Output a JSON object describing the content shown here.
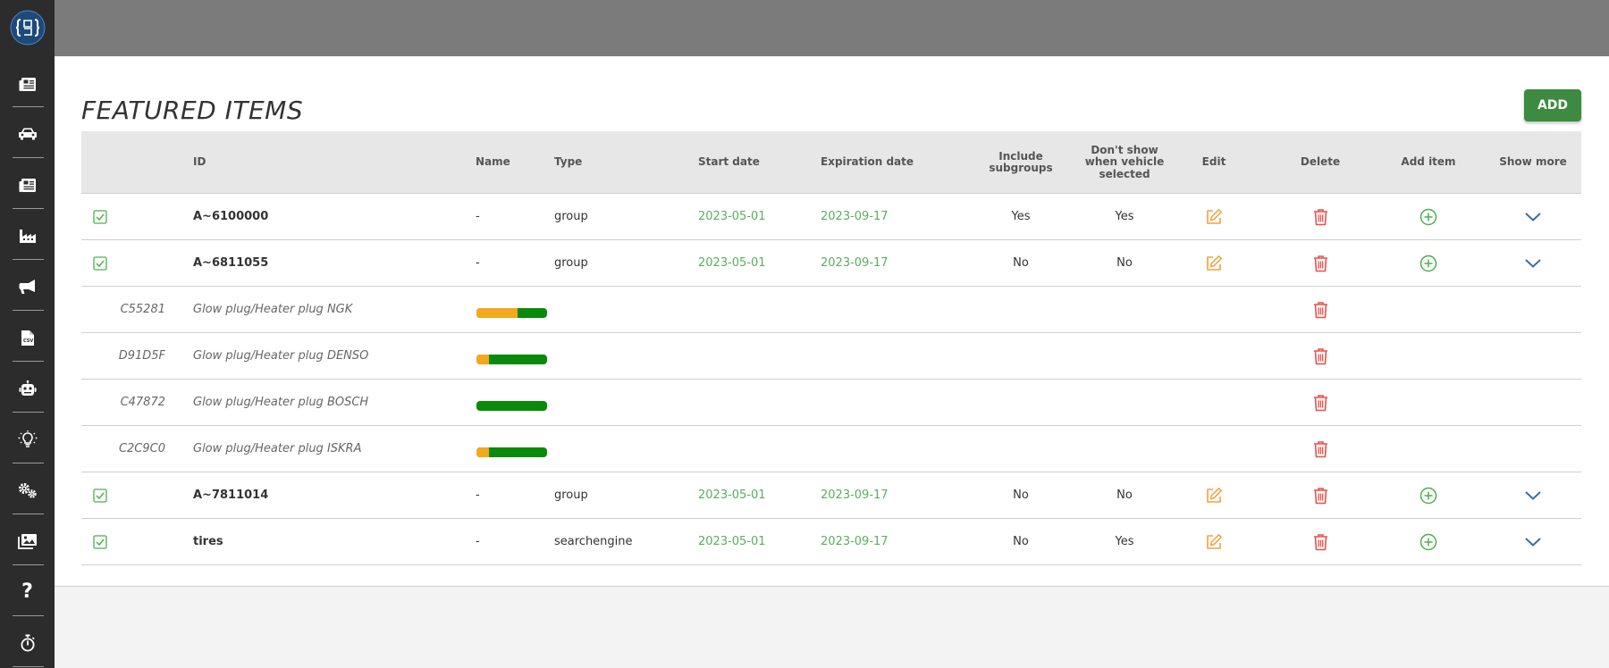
{
  "page": {
    "title": "FEATURED ITEMS",
    "add_label": "ADD"
  },
  "columns": {
    "id": "ID",
    "name": "Name",
    "type": "Type",
    "start_date": "Start date",
    "expiration_date": "Expiration date",
    "include_subgroups": "Include subgroups",
    "dont_show": "Don't show when vehicle selected",
    "edit": "Edit",
    "delete": "Delete",
    "add_item": "Add item",
    "show_more": "Show more"
  },
  "rows": [
    {
      "id": "A~6100000",
      "name": "-",
      "type": "group",
      "start": "2023-05-01",
      "exp": "2023-09-17",
      "include": "Yes",
      "dontshow": "Yes"
    },
    {
      "id": "A~6811055",
      "name": "-",
      "type": "group",
      "start": "2023-05-01",
      "exp": "2023-09-17",
      "include": "No",
      "dontshow": "No"
    },
    {
      "id": "A~7811014",
      "name": "-",
      "type": "group",
      "start": "2023-05-01",
      "exp": "2023-09-17",
      "include": "No",
      "dontshow": "No"
    },
    {
      "id": "tires",
      "name": "-",
      "type": "searchengine",
      "start": "2023-05-01",
      "exp": "2023-09-17",
      "include": "No",
      "dontshow": "Yes"
    }
  ],
  "subitems": [
    {
      "code": "C55281",
      "name": "Glow plug/Heater plug NGK",
      "orange_fraction": 0.58
    },
    {
      "code": "D91D5F",
      "name": "Glow plug/Heater plug DENSO",
      "orange_fraction": 0.18
    },
    {
      "code": "C47872",
      "name": "Glow plug/Heater plug BOSCH",
      "orange_fraction": 0.0
    },
    {
      "code": "C2C9C0",
      "name": "Glow plug/Heater plug ISKRA",
      "orange_fraction": 0.18
    }
  ],
  "sidebar": {
    "icons": [
      "news-icon",
      "car-icon",
      "news-icon",
      "factory-icon",
      "megaphone-icon",
      "csv-file-icon",
      "robot-icon",
      "lightbulb-icon",
      "gears-icon",
      "images-icon",
      "help-icon",
      "stopwatch-icon"
    ],
    "help_glyph": "?"
  },
  "colors": {
    "sidebar": "#2c2c2c",
    "topbar": "#7b7b7b",
    "add_button": "#3d8b40",
    "date_green": "#5aad5f",
    "edit_orange": "#f0a23b",
    "delete_red": "#e8514a",
    "add_green": "#4caf50",
    "chevron_blue": "#3b6e9e",
    "bar_green": "#0a8a0a",
    "bar_orange": "#f4a81d"
  }
}
